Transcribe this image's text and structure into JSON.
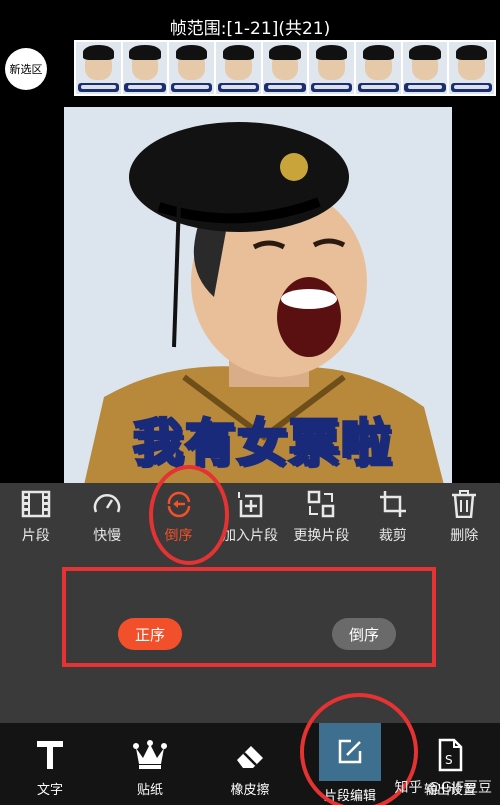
{
  "header": {
    "frame_range": "帧范围:[1-21](共21)",
    "new_selection_label": "新选区"
  },
  "filmstrip": {
    "thumb_count": 9
  },
  "preview": {
    "caption": "我有女票啦"
  },
  "toolbar": {
    "items": [
      {
        "label": "片段",
        "icon": "film-icon"
      },
      {
        "label": "快慢",
        "icon": "speedometer-icon"
      },
      {
        "label": "倒序",
        "icon": "reverse-icon",
        "active": true
      },
      {
        "label": "加入片段",
        "icon": "add-clip-icon"
      },
      {
        "label": "更换片段",
        "icon": "replace-clip-icon"
      },
      {
        "label": "裁剪",
        "icon": "crop-icon"
      },
      {
        "label": "删除",
        "icon": "trash-icon"
      }
    ]
  },
  "order": {
    "forward_label": "正序",
    "reverse_label": "倒序",
    "selected": "正序"
  },
  "bottom_bar": {
    "items": [
      {
        "label": "文字",
        "icon": "text-icon"
      },
      {
        "label": "贴纸",
        "icon": "crown-icon"
      },
      {
        "label": "橡皮擦",
        "icon": "eraser-icon"
      },
      {
        "label": "片段编辑",
        "icon": "edit-icon",
        "active": true
      },
      {
        "label": "输出设置",
        "icon": "output-file-icon"
      }
    ]
  },
  "watermark": "知乎 @GIF豆豆",
  "colors": {
    "accent": "#f2502a",
    "annotation_red": "#e53232",
    "panel_bg": "#3a3a3a"
  }
}
